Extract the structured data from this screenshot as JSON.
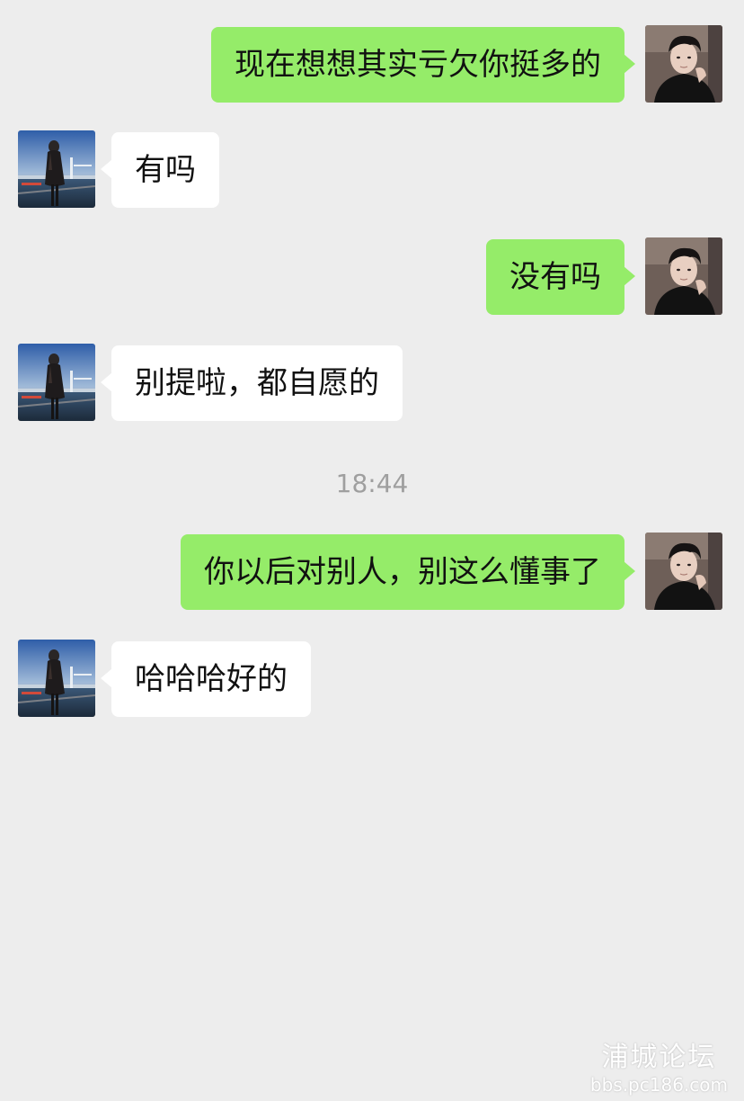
{
  "conversation": {
    "messages": [
      {
        "side": "outgoing",
        "text": "现在想想其实亏欠你挺多的",
        "avatar": "male-avatar"
      },
      {
        "side": "incoming",
        "text": "有吗",
        "avatar": "female-avatar"
      },
      {
        "side": "outgoing",
        "text": "没有吗",
        "avatar": "male-avatar"
      },
      {
        "side": "incoming",
        "text": "别提啦，都自愿的",
        "avatar": "female-avatar"
      },
      {
        "side": "outgoing",
        "text": "你以后对别人，别这么懂事了",
        "avatar": "male-avatar"
      },
      {
        "side": "incoming",
        "text": "哈哈哈好的",
        "avatar": "female-avatar"
      }
    ],
    "timestamp": "18:44"
  },
  "watermark": {
    "title": "浦城论坛",
    "url": "bbs.pc186.com"
  },
  "colors": {
    "background": "#ededed",
    "outgoing_bubble": "#95ec69",
    "incoming_bubble": "#ffffff",
    "timestamp_text": "#9f9f9f"
  }
}
